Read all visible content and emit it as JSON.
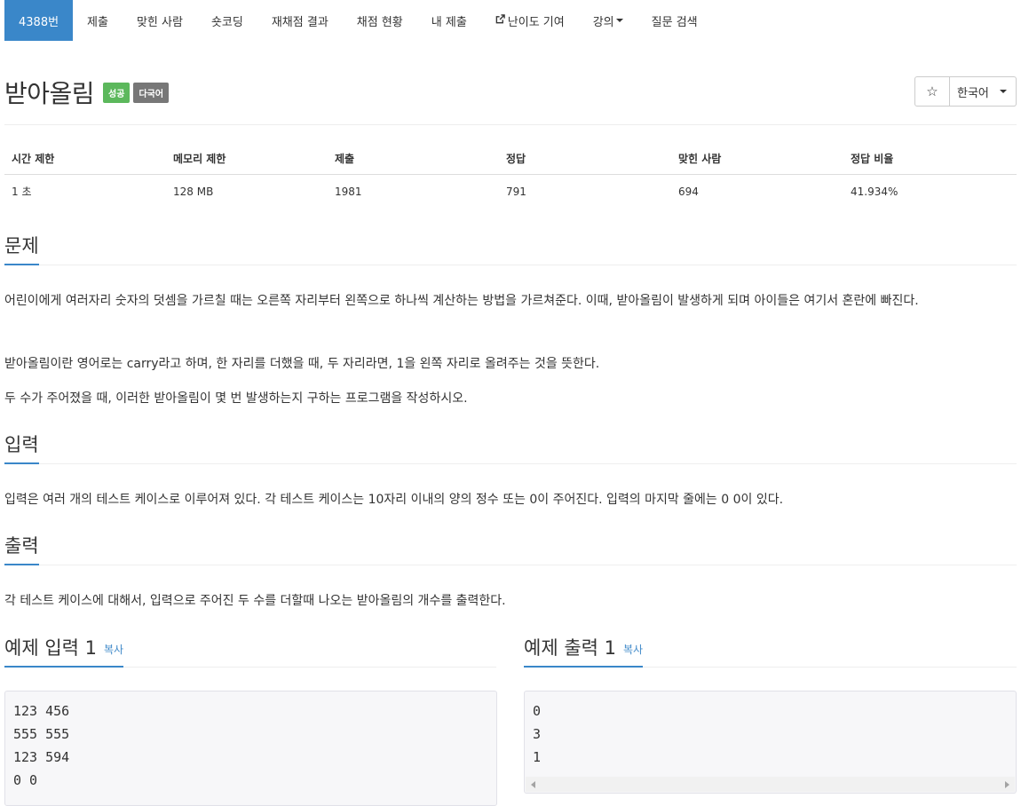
{
  "nav": {
    "items": [
      {
        "label": "4388번",
        "active": true
      },
      {
        "label": "제출"
      },
      {
        "label": "맞힌 사람"
      },
      {
        "label": "숏코딩"
      },
      {
        "label": "재채점 결과"
      },
      {
        "label": "채점 현황"
      },
      {
        "label": "내 제출"
      },
      {
        "label": "난이도 기여",
        "icon": "external-link-icon"
      },
      {
        "label": "강의",
        "dropdown": true
      },
      {
        "label": "질문 검색"
      }
    ]
  },
  "problem": {
    "title": "받아올림",
    "badges": [
      {
        "label": "성공",
        "color": "#5cb85c"
      },
      {
        "label": "다국어",
        "color": "#777777"
      }
    ]
  },
  "controls": {
    "star_icon": "☆",
    "language": "한국어"
  },
  "info_table": {
    "headers": [
      "시간 제한",
      "메모리 제한",
      "제출",
      "정답",
      "맞힌 사람",
      "정답 비율"
    ],
    "row": [
      "1 초",
      "128 MB",
      "1981",
      "791",
      "694",
      "41.934%"
    ]
  },
  "sections": {
    "problem": {
      "heading": "문제",
      "paragraphs": [
        "어린이에게 여러자리 숫자의 덧셈을 가르칠 때는 오른쪽 자리부터 왼쪽으로 하나씩 계산하는 방법을 가르쳐준다. 이때, 받아올림이 발생하게 되며 아이들은 여기서 혼란에 빠진다.",
        "받아올림이란 영어로는 carry라고 하며, 한 자리를 더했을 때, 두 자리라면, 1을 왼쪽 자리로 올려주는 것을 뜻한다.",
        "두 수가 주어졌을 때, 이러한 받아올림이 몇 번 발생하는지 구하는 프로그램을 작성하시오."
      ]
    },
    "input": {
      "heading": "입력",
      "text": "입력은 여러 개의 테스트 케이스로 이루어져 있다. 각 테스트 케이스는 10자리 이내의 양의 정수 또는 0이 주어진다. 입력의 마지막 줄에는 0 0이 있다."
    },
    "output": {
      "heading": "출력",
      "text": "각 테스트 케이스에 대해서, 입력으로 주어진 두 수를 더할때 나오는 받아올림의 개수를 출력한다."
    },
    "sample_input": {
      "heading": "예제 입력 1",
      "copy": "복사",
      "lines": [
        "123 456",
        "555 555",
        "123 594",
        "0 0"
      ]
    },
    "sample_output": {
      "heading": "예제 출력 1",
      "copy": "복사",
      "lines": [
        "0",
        "3",
        "1"
      ]
    }
  }
}
